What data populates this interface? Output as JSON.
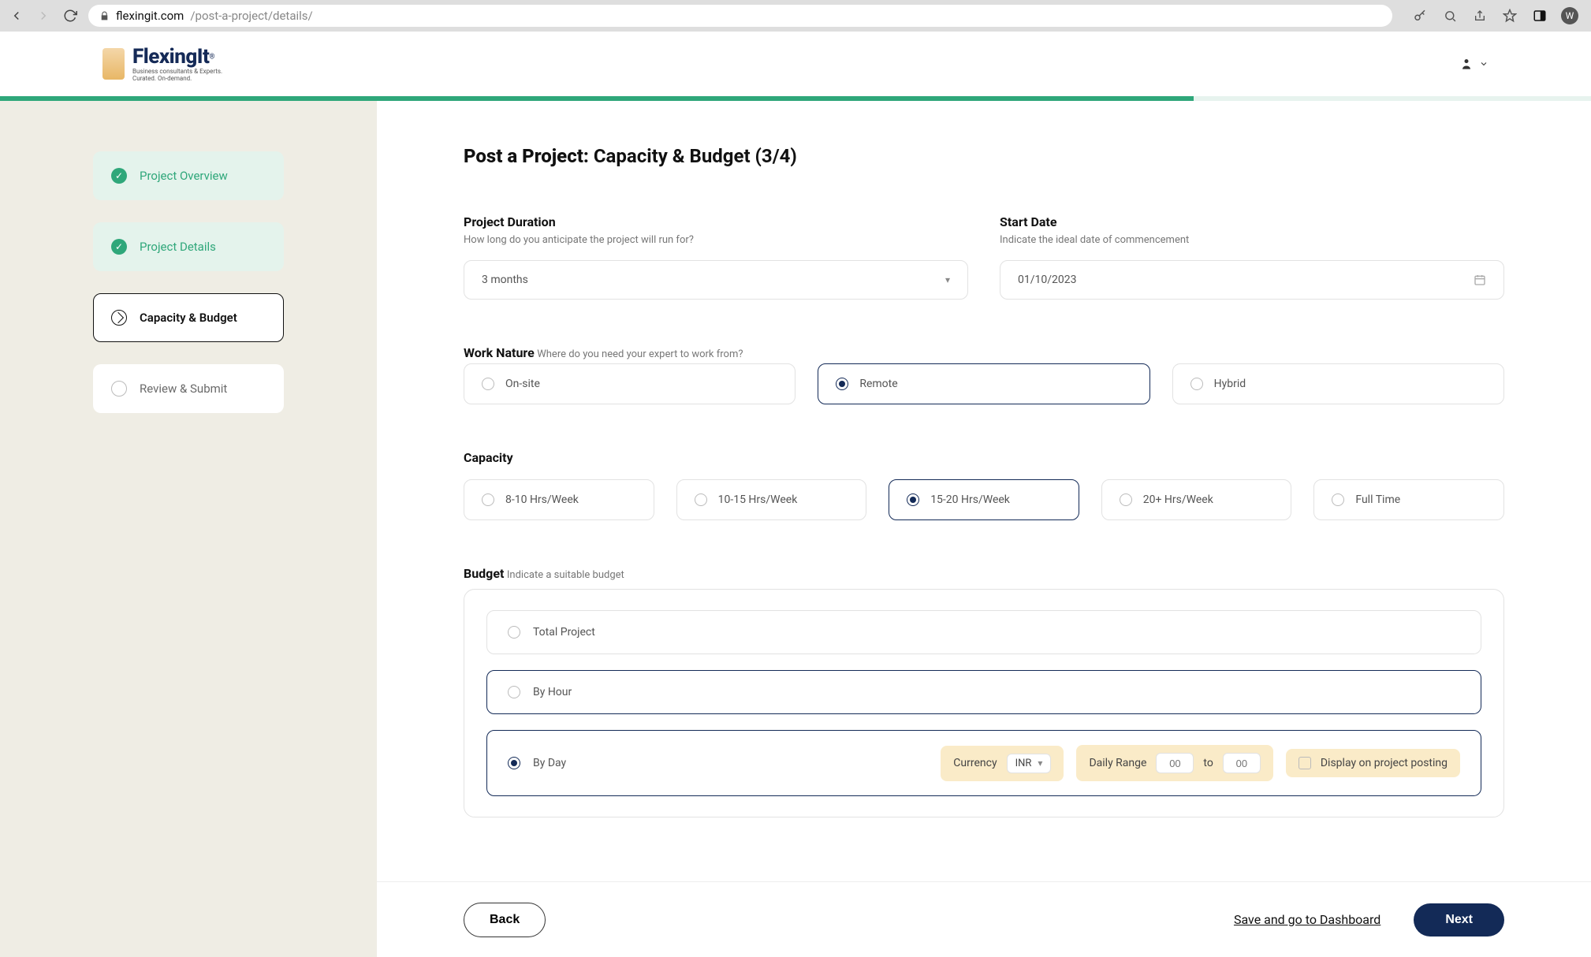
{
  "browser": {
    "url_host": "flexingit.com",
    "url_path": "/post-a-project/details/",
    "avatar_initial": "W"
  },
  "header": {
    "logo_title": "FlexingIt",
    "logo_sup": "®",
    "logo_sub1": "Business consultants & Experts.",
    "logo_sub2": "Curated. On-demand."
  },
  "progress_pct": 75,
  "sidebar": {
    "steps": [
      {
        "label": "Project Overview",
        "state": "done"
      },
      {
        "label": "Project Details",
        "state": "done"
      },
      {
        "label": "Capacity & Budget",
        "state": "active"
      },
      {
        "label": "Review & Submit",
        "state": "pending"
      }
    ]
  },
  "page": {
    "title_bold": "Post a Project:",
    "title_rest": " Capacity & Budget (3/4)"
  },
  "duration": {
    "label": "Project Duration",
    "help": "How long do you anticipate the project will run for?",
    "value": "3 months"
  },
  "start_date": {
    "label": "Start Date",
    "help": "Indicate the ideal date of commencement",
    "value": "01/10/2023"
  },
  "work_nature": {
    "label": "Work Nature",
    "help": "Where do you need your expert to work from?",
    "options": [
      "On-site",
      "Remote",
      "Hybrid"
    ],
    "selected": 1
  },
  "capacity": {
    "label": "Capacity",
    "options": [
      "8-10 Hrs/Week",
      "10-15 Hrs/Week",
      "15-20 Hrs/Week",
      "20+ Hrs/Week",
      "Full Time"
    ],
    "selected": 2
  },
  "budget": {
    "label": "Budget",
    "help": "Indicate a suitable budget",
    "options": [
      "Total Project",
      "By Hour",
      "By Day"
    ],
    "selected": 2,
    "currency_label": "Currency",
    "currency_value": "INR",
    "range_label": "Daily Range",
    "range_from_placeholder": "00",
    "range_to_label": "to",
    "range_to_placeholder": "00",
    "display_label": "Display on project posting"
  },
  "footer": {
    "back": "Back",
    "save": "Save and go to Dashboard",
    "next": "Next"
  }
}
